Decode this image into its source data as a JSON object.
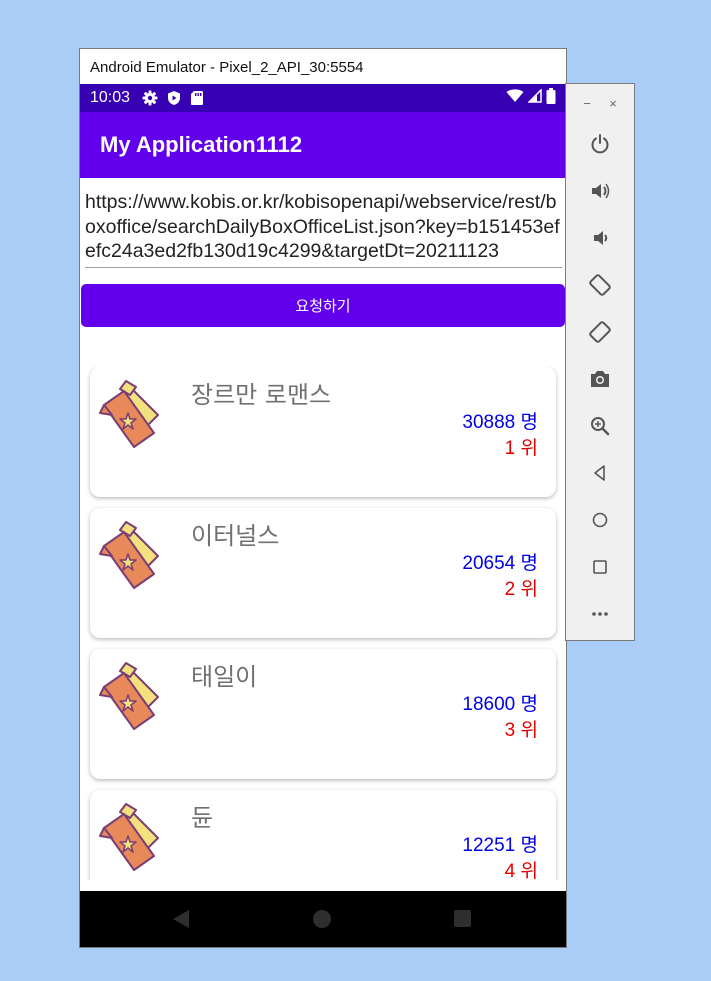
{
  "window": {
    "title": "Android Emulator - Pixel_2_API_30:5554"
  },
  "status_bar": {
    "time": "10:03",
    "left_icons": [
      "gear-icon",
      "shield-icon",
      "sd-card-icon"
    ],
    "right_icons": [
      "wifi-icon",
      "signal-icon",
      "battery-icon"
    ]
  },
  "app_bar": {
    "title": "My Application1112"
  },
  "url_field": {
    "value": "https://www.kobis.or.kr/kobisopenapi/webservice/rest/boxoffice/searchDailyBoxOfficeList.json?key=b151453efefc24a3ed2fb130d19c4299&targetDt=20211123"
  },
  "request_button": {
    "label": "요청하기"
  },
  "movies": [
    {
      "title": "장르만 로맨스",
      "audience": "30888 명",
      "rank": "1 위"
    },
    {
      "title": "이터널스",
      "audience": "20654 명",
      "rank": "2 위"
    },
    {
      "title": "태일이",
      "audience": "18600 명",
      "rank": "3 위"
    },
    {
      "title": "듄",
      "audience": "12251 명",
      "rank": "4 위"
    }
  ],
  "colors": {
    "status_bar": "#3700b3",
    "primary": "#6200ee",
    "audience_text": "#0000e6",
    "rank_text": "#e60000",
    "desktop": "#a9cdf7"
  },
  "side_toolbar": {
    "window_controls": [
      "−",
      "×"
    ],
    "tools": [
      "power-icon",
      "volume-up-icon",
      "volume-down-icon",
      "rotate-left-icon",
      "rotate-right-icon",
      "camera-icon",
      "zoom-icon",
      "back-icon",
      "home-icon",
      "overview-icon",
      "more-icon"
    ]
  }
}
